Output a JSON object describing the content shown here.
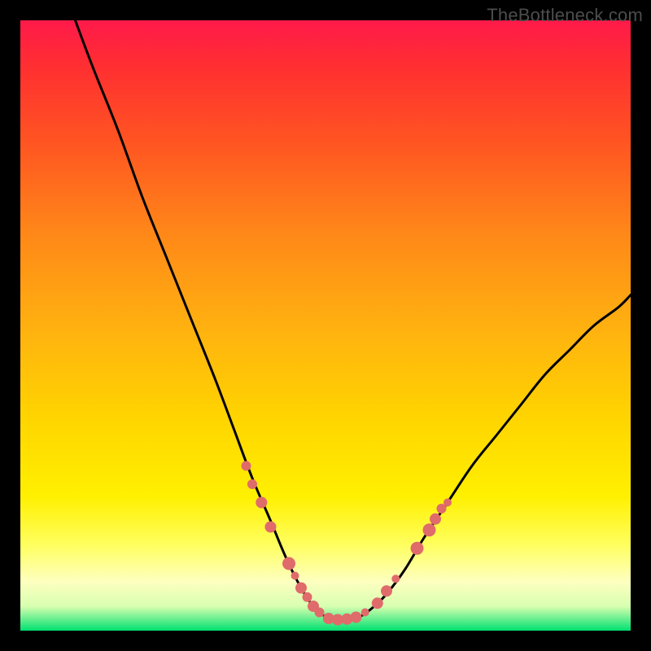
{
  "watermark": "TheBottleneck.com",
  "chart_data": {
    "type": "line",
    "title": "",
    "xlabel": "",
    "ylabel": "",
    "xlim": [
      0,
      100
    ],
    "ylim": [
      0,
      100
    ],
    "series": [
      {
        "name": "bottleneck-curve",
        "x": [
          9,
          12,
          16,
          20,
          24,
          28,
          32,
          35,
          38,
          41,
          43.5,
          46,
          48,
          50,
          52,
          54,
          56,
          58,
          60,
          63,
          66,
          70,
          74,
          78,
          82,
          86,
          90,
          94,
          98,
          100
        ],
        "y": [
          100,
          92,
          82,
          71,
          61,
          51,
          41,
          33,
          25,
          18,
          12,
          7,
          4,
          2.3,
          1.8,
          1.8,
          2.5,
          4,
          6,
          10,
          15,
          21,
          27,
          32,
          37,
          42,
          46,
          50,
          53,
          55
        ]
      }
    ],
    "markers": {
      "name": "highlight-points",
      "color": "#e06b6b",
      "points": [
        {
          "x": 37.0,
          "y": 27.0,
          "r": 6
        },
        {
          "x": 38.0,
          "y": 24.0,
          "r": 6
        },
        {
          "x": 39.5,
          "y": 21.0,
          "r": 7
        },
        {
          "x": 41.0,
          "y": 17.0,
          "r": 7
        },
        {
          "x": 44.0,
          "y": 11.0,
          "r": 8
        },
        {
          "x": 45.0,
          "y": 9.0,
          "r": 5
        },
        {
          "x": 46.0,
          "y": 7.0,
          "r": 7
        },
        {
          "x": 47.0,
          "y": 5.5,
          "r": 6
        },
        {
          "x": 48.0,
          "y": 4.0,
          "r": 7
        },
        {
          "x": 49.0,
          "y": 3.0,
          "r": 6
        },
        {
          "x": 50.5,
          "y": 2.0,
          "r": 7
        },
        {
          "x": 52.0,
          "y": 1.8,
          "r": 7
        },
        {
          "x": 53.5,
          "y": 1.9,
          "r": 7
        },
        {
          "x": 55.0,
          "y": 2.2,
          "r": 7
        },
        {
          "x": 56.5,
          "y": 3.0,
          "r": 5
        },
        {
          "x": 58.5,
          "y": 4.5,
          "r": 7
        },
        {
          "x": 60.0,
          "y": 6.5,
          "r": 7
        },
        {
          "x": 61.5,
          "y": 8.5,
          "r": 5
        },
        {
          "x": 65.0,
          "y": 13.5,
          "r": 8
        },
        {
          "x": 67.0,
          "y": 16.5,
          "r": 8
        },
        {
          "x": 68.0,
          "y": 18.3,
          "r": 7
        },
        {
          "x": 69.0,
          "y": 20.0,
          "r": 6
        },
        {
          "x": 70.0,
          "y": 21.0,
          "r": 5
        }
      ]
    }
  }
}
